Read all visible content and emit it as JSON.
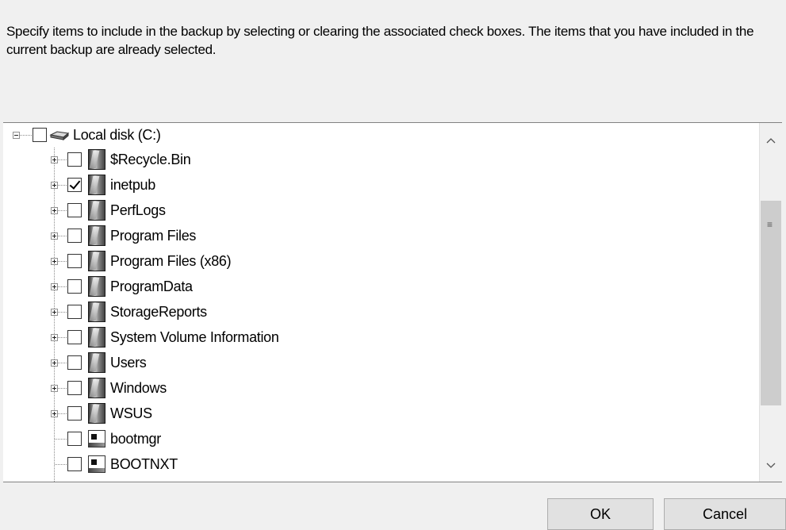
{
  "instructions": "Specify items to include in the backup by selecting or clearing the associated check boxes. The items that you have included in the current backup are already selected.",
  "tree": {
    "root": {
      "label": "Local disk (C:)",
      "checked": false,
      "expanded": true,
      "icon": "drive-icon"
    },
    "children": [
      {
        "label": "$Recycle.Bin",
        "checked": false,
        "type": "folder",
        "expandable": true
      },
      {
        "label": "inetpub",
        "checked": true,
        "type": "folder",
        "expandable": true
      },
      {
        "label": "PerfLogs",
        "checked": false,
        "type": "folder",
        "expandable": true
      },
      {
        "label": "Program Files",
        "checked": false,
        "type": "folder",
        "expandable": true
      },
      {
        "label": "Program Files (x86)",
        "checked": false,
        "type": "folder",
        "expandable": true
      },
      {
        "label": "ProgramData",
        "checked": false,
        "type": "folder",
        "expandable": true
      },
      {
        "label": "StorageReports",
        "checked": false,
        "type": "folder",
        "expandable": true
      },
      {
        "label": "System Volume Information",
        "checked": false,
        "type": "folder",
        "expandable": true
      },
      {
        "label": "Users",
        "checked": false,
        "type": "folder",
        "expandable": true
      },
      {
        "label": "Windows",
        "checked": false,
        "type": "folder",
        "expandable": true
      },
      {
        "label": "WSUS",
        "checked": false,
        "type": "folder",
        "expandable": true
      },
      {
        "label": "bootmgr",
        "checked": false,
        "type": "file",
        "expandable": false
      },
      {
        "label": "BOOTNXT",
        "checked": false,
        "type": "file",
        "expandable": false
      }
    ]
  },
  "scrollbar": {
    "up_icon": "chevron-up-icon",
    "down_icon": "chevron-down-icon",
    "grip_icon": "scroll-grip-icon"
  },
  "buttons": {
    "ok": "OK",
    "cancel": "Cancel"
  }
}
